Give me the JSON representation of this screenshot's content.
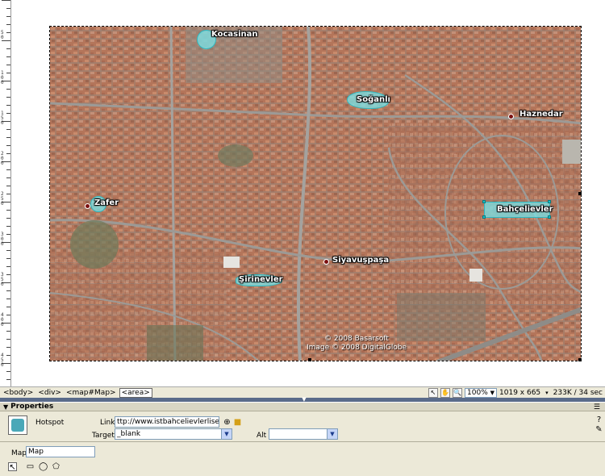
{
  "ruler": {
    "labels": [
      "50",
      "100",
      "150",
      "200",
      "250",
      "300",
      "350",
      "400",
      "450"
    ]
  },
  "map": {
    "places": [
      {
        "name": "Kocasinan",
        "type": "circle-hotspot"
      },
      {
        "name": "Soğanlı",
        "type": "poly-hotspot"
      },
      {
        "name": "Haznedar",
        "type": "pin"
      },
      {
        "name": "Zafer",
        "type": "circle-hotspot"
      },
      {
        "name": "Bahçelievler",
        "type": "rect-hotspot"
      },
      {
        "name": "Siyavuşpaşa",
        "type": "pin"
      },
      {
        "name": "Şirinevler",
        "type": "poly-hotspot"
      }
    ],
    "copyright_line1": "© 2008 Basarsoft",
    "copyright_line2": "Image © 2008 DigitalGlobe"
  },
  "status_bar": {
    "tags": [
      "<body>",
      "<div>",
      "<map#Map>",
      "<area>"
    ],
    "selected_tag": "<area>",
    "zoom": "100%",
    "dimensions": "1019 x 665",
    "download": "233K / 34 sec"
  },
  "properties": {
    "title": "Properties",
    "element_type": "Hotspot",
    "link_label": "Link",
    "link_value": "ttp://www.istbahcelievlerlisesi.com/",
    "target_label": "Target",
    "target_value": "_blank",
    "alt_label": "Alt",
    "alt_value": "",
    "map_label": "Map",
    "map_value": "Map"
  },
  "colors": {
    "hotspot_fill": "#78e6eb",
    "panel_bg": "#ece9d8",
    "splitter": "#5a6b8a"
  }
}
